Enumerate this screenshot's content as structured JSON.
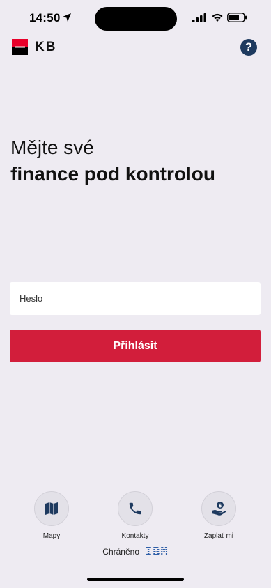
{
  "status_bar": {
    "time": "14:50",
    "icons": [
      "location-arrow-icon",
      "cellular-signal-icon",
      "wifi-icon",
      "battery-icon"
    ]
  },
  "header": {
    "logo_text": "KB",
    "help_label": "?"
  },
  "headline": {
    "line1": "Mějte své",
    "line2": "finance pod kontrolou"
  },
  "form": {
    "password_placeholder": "Heslo",
    "login_label": "Přihlásit"
  },
  "shortcuts": [
    {
      "label": "Mapy",
      "icon": "map-icon"
    },
    {
      "label": "Kontakty",
      "icon": "phone-icon"
    },
    {
      "label": "Zaplať mi",
      "icon": "pay-me-icon"
    }
  ],
  "footer": {
    "protected_label": "Chráněno",
    "partner_logo": "IBM"
  },
  "colors": {
    "background": "#eeebf2",
    "brand_red": "#d21e3b",
    "help_navy": "#1e3a5f",
    "ibm_blue": "#2f5fa8"
  }
}
